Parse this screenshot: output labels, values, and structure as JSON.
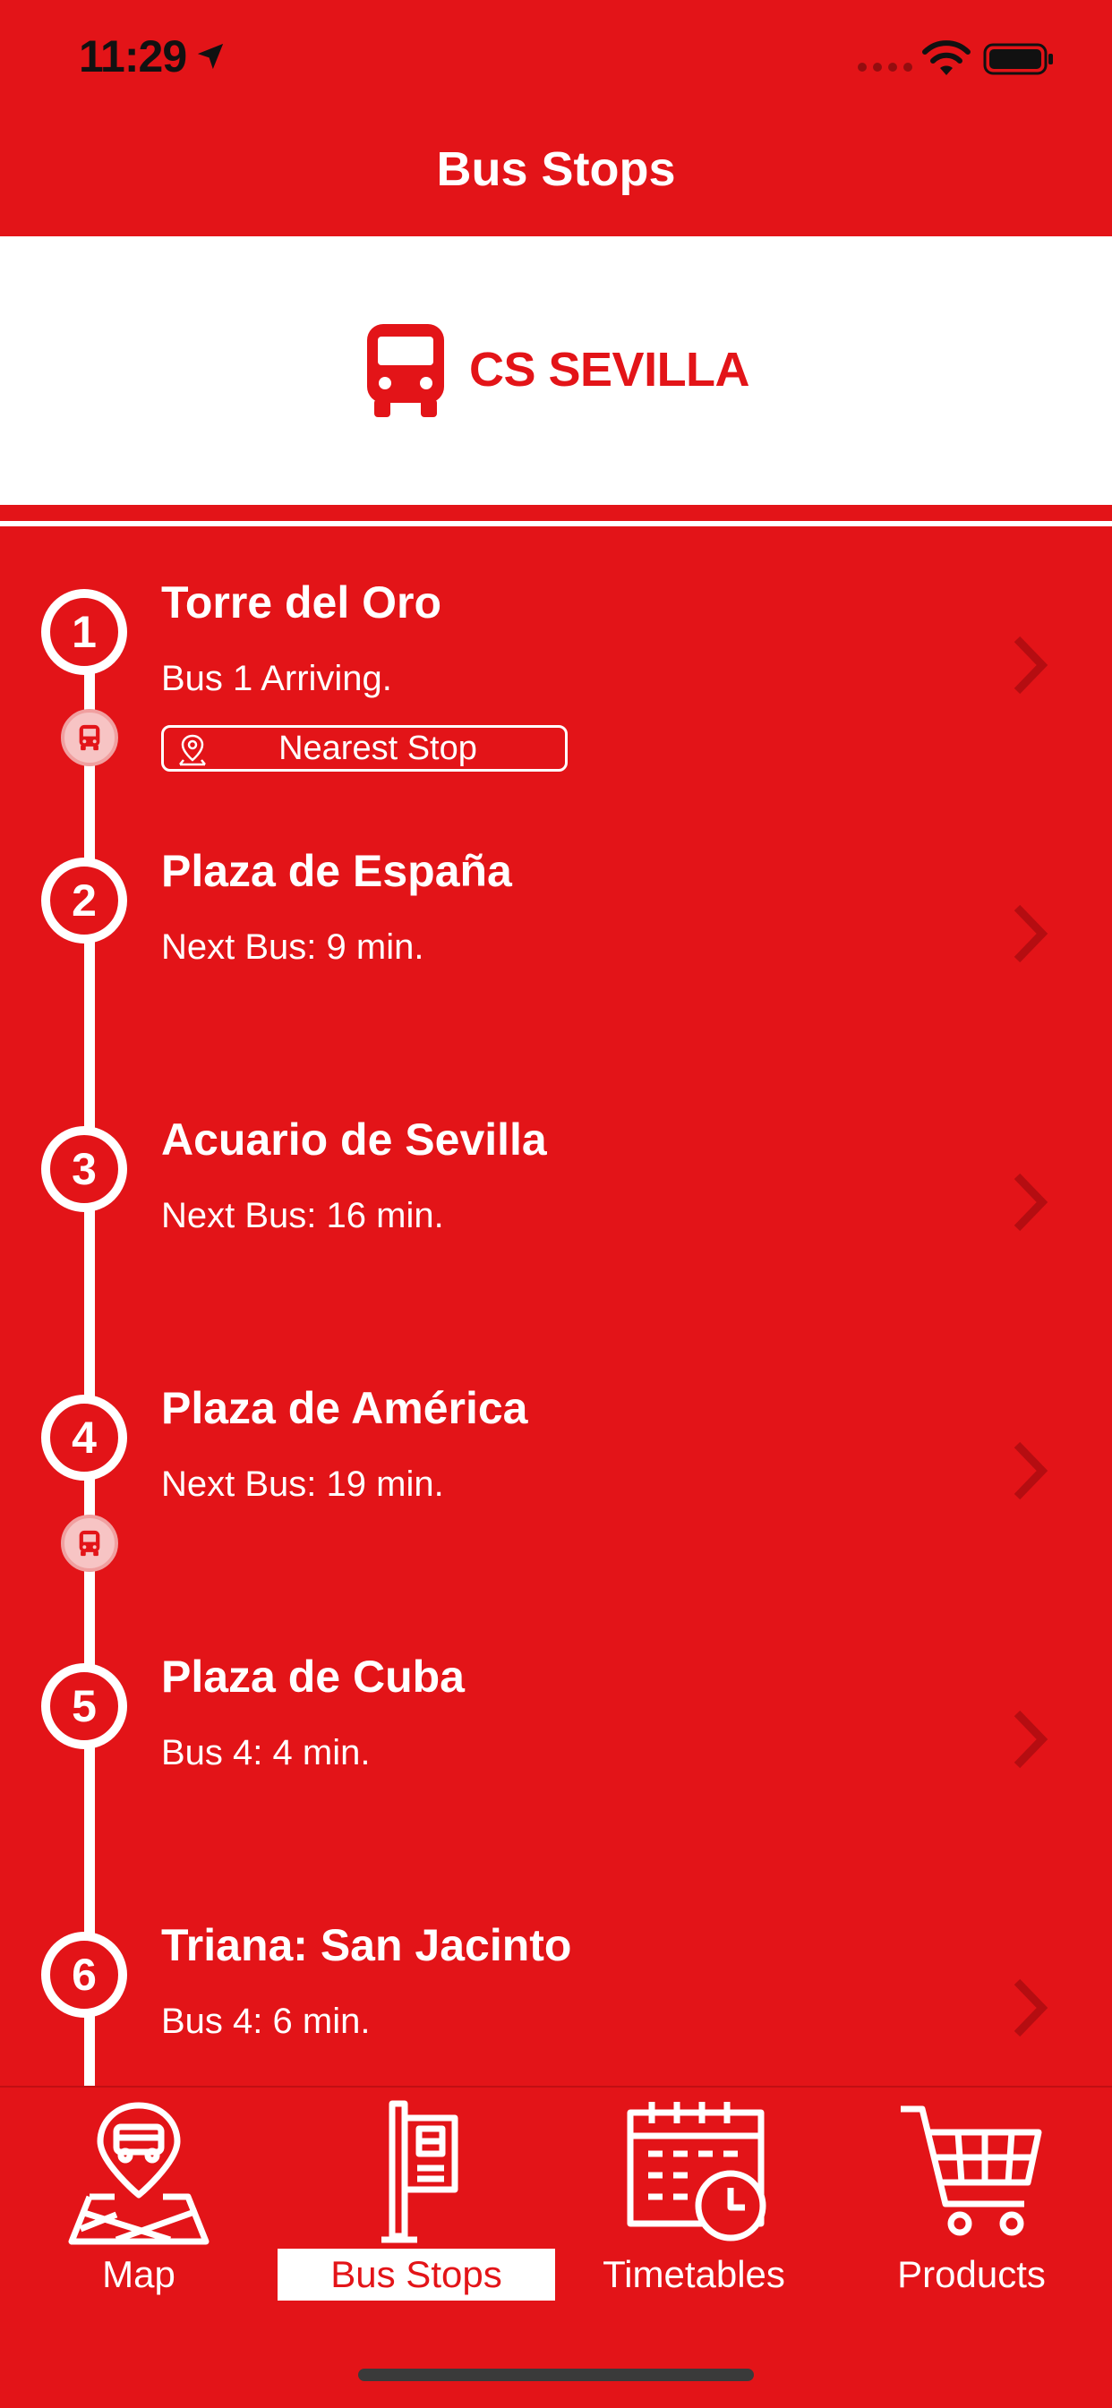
{
  "status_bar": {
    "time": "11:29"
  },
  "nav": {
    "title": "Bus Stops"
  },
  "brand": {
    "name": "CS SEVILLA"
  },
  "stops": [
    {
      "number": "1",
      "name": "Torre del Oro",
      "status": "Bus 1 Arriving.",
      "badge": "Nearest Stop"
    },
    {
      "number": "2",
      "name": "Plaza de España",
      "status": "Next Bus: 9 min."
    },
    {
      "number": "3",
      "name": "Acuario de Sevilla",
      "status": "Next Bus: 16 min."
    },
    {
      "number": "4",
      "name": "Plaza de América",
      "status": "Next Bus: 19 min."
    },
    {
      "number": "5",
      "name": "Plaza de Cuba",
      "status": "Bus 4: 4 min."
    },
    {
      "number": "6",
      "name": "Triana: San Jacinto",
      "status": "Bus 4: 6 min."
    }
  ],
  "tabs": [
    {
      "label": "Map",
      "icon": "map-bus-icon"
    },
    {
      "label": "Bus Stops",
      "icon": "bus-stop-sign-icon",
      "active": true
    },
    {
      "label": "Timetables",
      "icon": "calendar-clock-icon"
    },
    {
      "label": "Products",
      "icon": "shopping-cart-icon"
    }
  ],
  "colors": {
    "primary": "#e31418",
    "white": "#ffffff",
    "chevron": "#b50d11"
  }
}
